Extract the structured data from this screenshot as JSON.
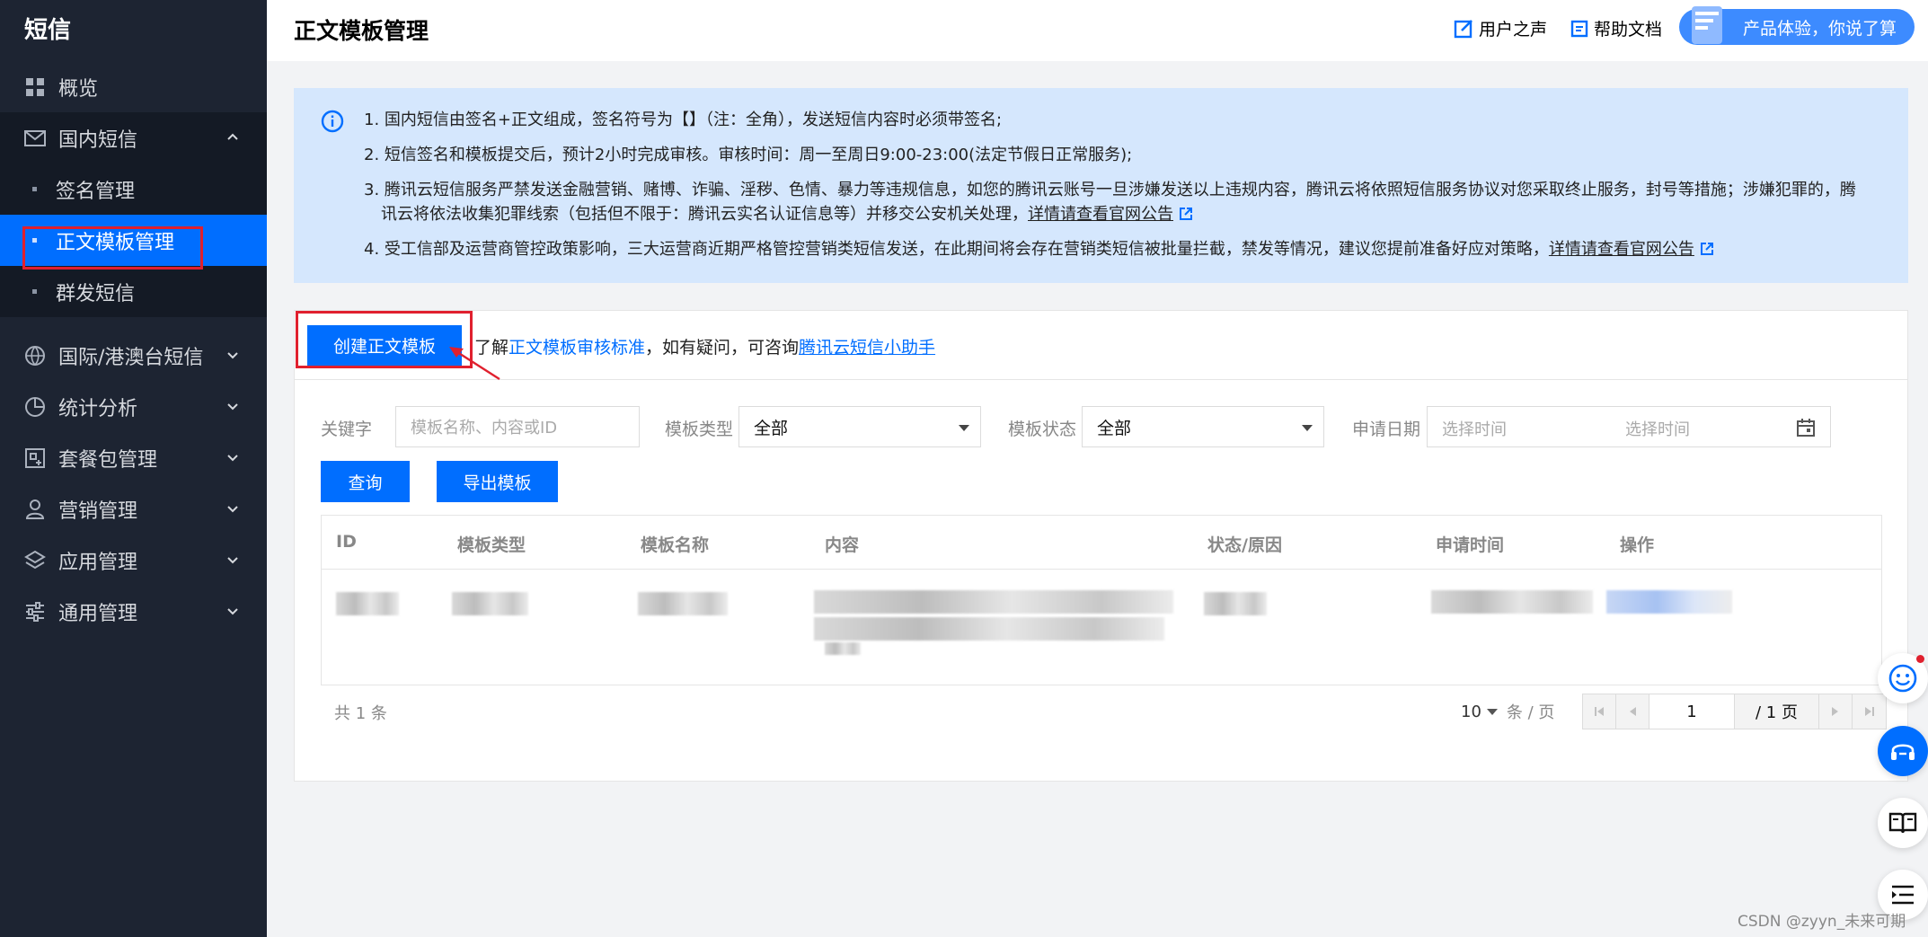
{
  "sidebar": {
    "brand": "短信",
    "items": [
      {
        "label": "概览",
        "icon": "grid-icon"
      },
      {
        "label": "国内短信",
        "icon": "mail-icon",
        "expanded": true,
        "children": [
          {
            "label": "签名管理"
          },
          {
            "label": "正文模板管理",
            "active": true
          },
          {
            "label": "群发短信"
          }
        ]
      },
      {
        "label": "国际/港澳台短信",
        "icon": "globe-icon"
      },
      {
        "label": "统计分析",
        "icon": "pie-chart-icon"
      },
      {
        "label": "套餐包管理",
        "icon": "package-icon"
      },
      {
        "label": "营销管理",
        "icon": "user-icon"
      },
      {
        "label": "应用管理",
        "icon": "layers-icon"
      },
      {
        "label": "通用管理",
        "icon": "sliders-icon"
      }
    ]
  },
  "topbar": {
    "title": "正文模板管理",
    "feedback_label": "用户之声",
    "docs_label": "帮助文档",
    "promo_label": "产品体验，你说了算"
  },
  "notice": {
    "items": [
      {
        "text": "1. 国内短信由签名+正文组成，签名符号为【】（注：全角），发送短信内容时必须带签名;"
      },
      {
        "text": "2. 短信签名和模板提交后，预计2小时完成审核。审核时间：周一至周日9:00-23:00(法定节假日正常服务);"
      },
      {
        "line1": "3. 腾讯云短信服务严禁发送金融营销、赌博、诈骗、淫秽、色情、暴力等违规信息，如您的腾讯云账号一旦涉嫌发送以上违规内容，腾讯云将依照短信服务协议对您采取终止服务，封号等措施；涉嫌犯罪的，腾",
        "line2": "讯云将依法收集犯罪线索（包括但不限于：腾讯云实名认证信息等）并移交公安机关处理，",
        "link": "详情请查看官网公告"
      },
      {
        "text": "4. 受工信部及运营商管控政策影响，三大运营商近期严格管控营销类短信发送，在此期间将会存在营销类短信被批量拦截，禁发等情况，建议您提前准备好应对策略，",
        "link": "详情请查看官网公告"
      }
    ]
  },
  "toolbar": {
    "create_label": "创建正文模板",
    "hint_prefix": "了解",
    "hint_link1": "正文模板审核标准",
    "hint_middle": "，如有疑问，可咨询",
    "hint_link2": "腾讯云短信小助手"
  },
  "filters": {
    "keyword_label": "关键字",
    "keyword_placeholder": "模板名称、内容或ID",
    "type_label": "模板类型",
    "type_value": "全部",
    "status_label": "模板状态",
    "status_value": "全部",
    "date_label": "申请日期",
    "date_start_placeholder": "选择时间",
    "date_end_placeholder": "选择时间",
    "query_label": "查询",
    "export_label": "导出模板"
  },
  "table": {
    "columns": [
      "ID",
      "模板类型",
      "模板名称",
      "内容",
      "状态/原因",
      "申请时间",
      "操作"
    ]
  },
  "pagination": {
    "total_text": "共 1 条",
    "page_size": "10",
    "page_size_unit": "条 / 页",
    "current_page": "1",
    "total_pages": "/ 1 页"
  },
  "watermark": "CSDN @zyyn_未来可期"
}
